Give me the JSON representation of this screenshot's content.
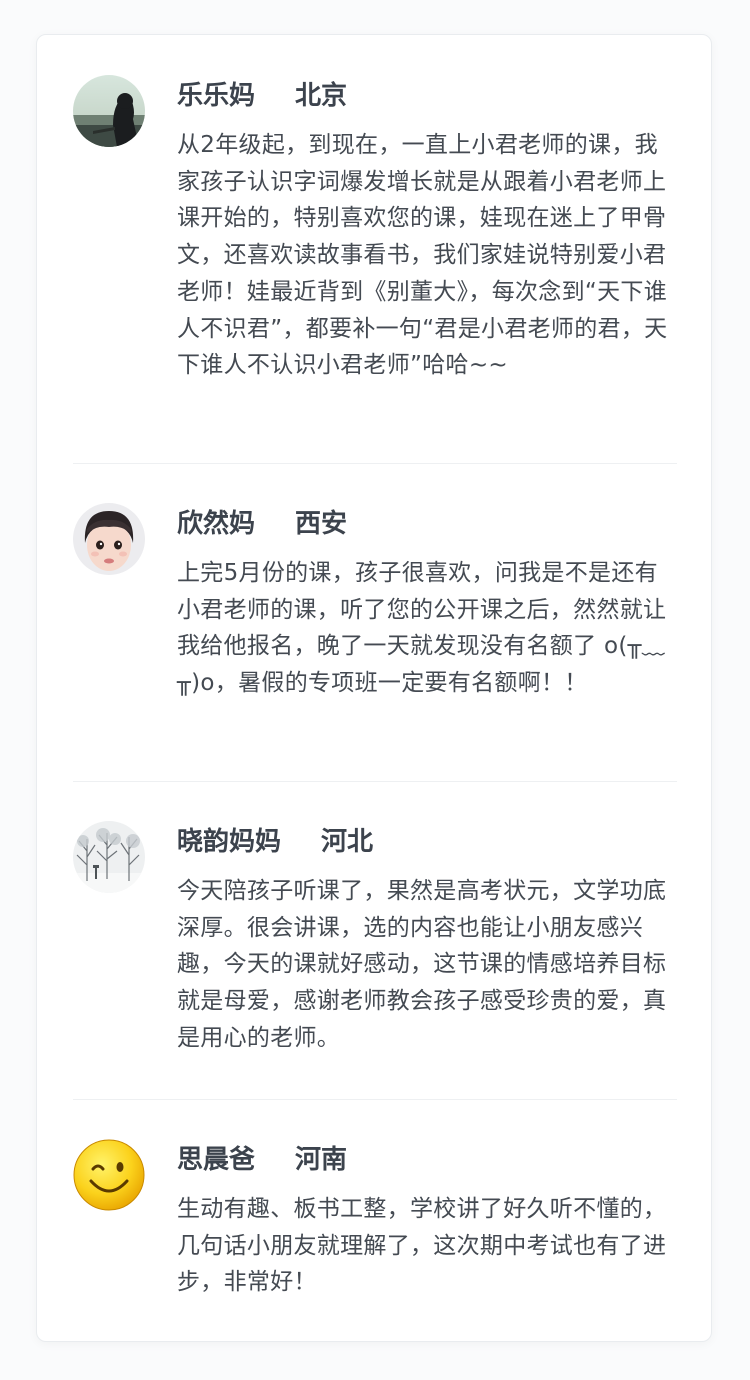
{
  "reviews": [
    {
      "name": "乐乐妈",
      "location": "北京",
      "avatar": "silhouette-lake-photo",
      "text": "从2年级起，到现在，一直上小君老师的课，我家孩子认识字词爆发增长就是从跟着小君老师上课开始的，特别喜欢您的课，娃现在迷上了甲骨文，还喜欢读故事看书，我们家娃说特别爱小君老师！娃最近背到《别董大》，每次念到“天下谁人不识君”，都要补一句“君是小君老师的君，天下谁人不认识小君老师”哈哈~~"
    },
    {
      "name": "欣然妈",
      "location": "西安",
      "avatar": "child-face-photo",
      "text": "上完5月份的课，孩子很喜欢，问我是不是还有小君老师的课，听了您的公开课之后，然然就让我给他报名，晚了一天就发现没有名额了 o(╥﹏╥)o，暑假的专项班一定要有名额啊！！"
    },
    {
      "name": "晓韵妈妈",
      "location": "河北",
      "avatar": "snowy-trees-photo",
      "text": "今天陪孩子听课了，果然是高考状元，文学功底深厚。很会讲课，选的内容也能让小朋友感兴趣，今天的课就好感动，这节课的情感培养目标就是母爱，感谢老师教会孩子感受珍贵的爱，真是用心的老师。"
    },
    {
      "name": "思晨爸",
      "location": "河南",
      "avatar": "winking-smiley-icon",
      "text": "生动有趣、板书工整，学校讲了好久听不懂的，几句话小朋友就理解了，这次期中考试也有了进步，非常好！"
    }
  ]
}
